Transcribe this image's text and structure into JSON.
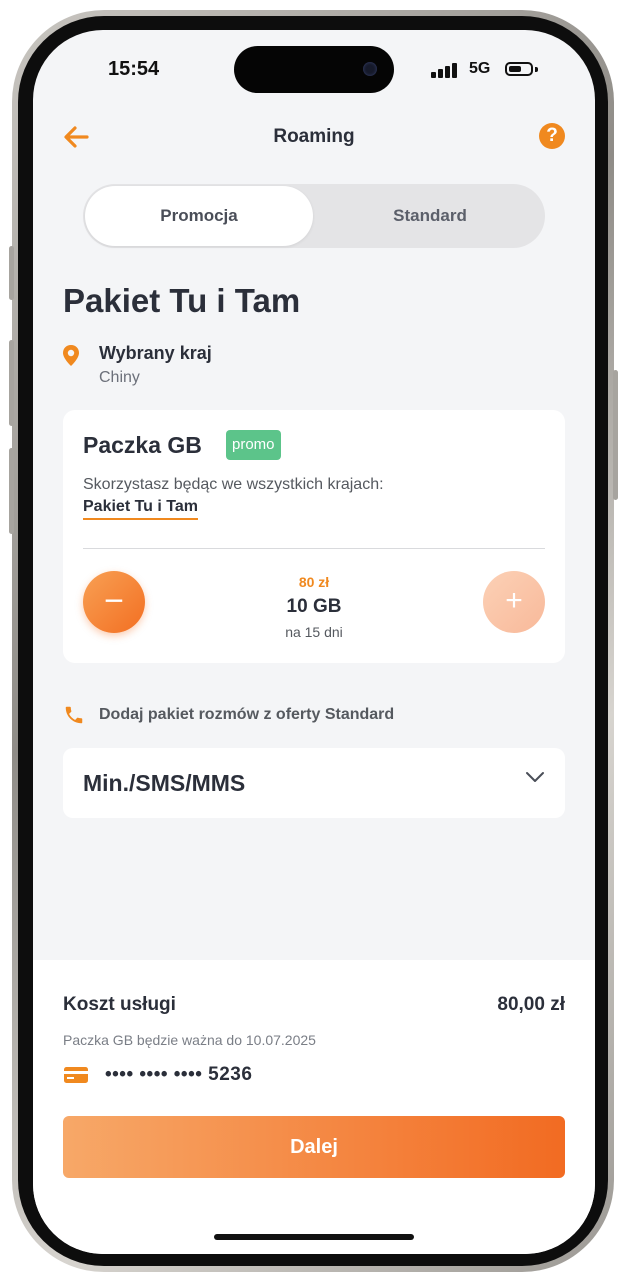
{
  "status_bar": {
    "time": "15:54",
    "network": "5G"
  },
  "header": {
    "title": "Roaming",
    "help_symbol": "?"
  },
  "tabs": [
    {
      "label": "Promocja",
      "active": true
    },
    {
      "label": "Standard",
      "active": false
    }
  ],
  "page_title": "Pakiet Tu i Tam",
  "location": {
    "label": "Wybrany kraj",
    "value": "Chiny"
  },
  "package_card": {
    "title": "Paczka GB",
    "badge": "promo",
    "description": "Skorzystasz będąc we wszystkich krajach:",
    "link": "Pakiet Tu i Tam",
    "price": "80 zł",
    "amount": "10 GB",
    "duration": "na 15 dni",
    "minus_symbol": "−",
    "plus_symbol": "+"
  },
  "calls": {
    "label": "Dodaj pakiet rozmów z oferty Standard"
  },
  "dropdown": {
    "label": "Min./SMS/MMS"
  },
  "summary": {
    "cost_label": "Koszt usługi",
    "cost_value": "80,00 zł",
    "validity": "Paczka GB będzie ważna do 10.07.2025",
    "card_number": "•••• •••• •••• 5236",
    "next_label": "Dalej"
  },
  "colors": {
    "accent": "#f0891f",
    "promo": "#5cc48a",
    "text": "#2b2f3a",
    "background": "#f4f5f7"
  }
}
